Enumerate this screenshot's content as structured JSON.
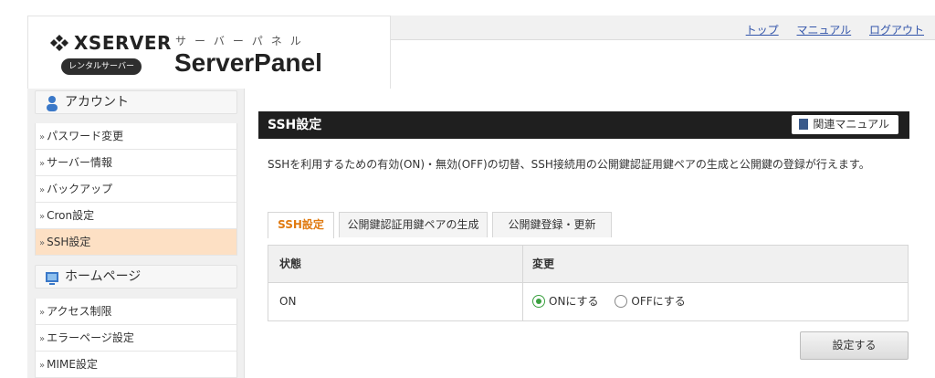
{
  "header": {
    "brand": "XSERVER",
    "badge": "レンタルサーバー",
    "subtitle": "サーバーパネル",
    "panel_title": "ServerPanel",
    "links": [
      "トップ",
      "マニュアル",
      "ログアウト"
    ]
  },
  "sidebar": {
    "account": {
      "title": "アカウント",
      "items": [
        "パスワード変更",
        "サーバー情報",
        "バックアップ",
        "Cron設定",
        "SSH設定"
      ]
    },
    "homepage": {
      "title": "ホームページ",
      "items": [
        "アクセス制限",
        "エラーページ設定",
        "MIME設定"
      ]
    },
    "active_item": "SSH設定"
  },
  "main": {
    "title": "SSH設定",
    "manual_label": "関連マニュアル",
    "description": "SSHを利用するための有効(ON)・無効(OFF)の切替、SSH接続用の公開鍵認証用鍵ペアの生成と公開鍵の登録が行えます。",
    "tabs": [
      "SSH設定",
      "公開鍵認証用鍵ペアの生成",
      "公開鍵登録・更新"
    ],
    "active_tab": "SSH設定",
    "table": {
      "col_state": "状態",
      "col_change": "変更",
      "state_value": "ON",
      "options": [
        "ONにする",
        "OFFにする"
      ],
      "selected_option": "ONにする"
    },
    "submit_label": "設定する"
  },
  "colors": {
    "active_tab_text": "#e07a10",
    "active_sidebar_bg": "#fde0c4",
    "title_bar_bg": "#1f1f1f",
    "radio_selected": "#3aa040",
    "link": "#3355aa"
  }
}
